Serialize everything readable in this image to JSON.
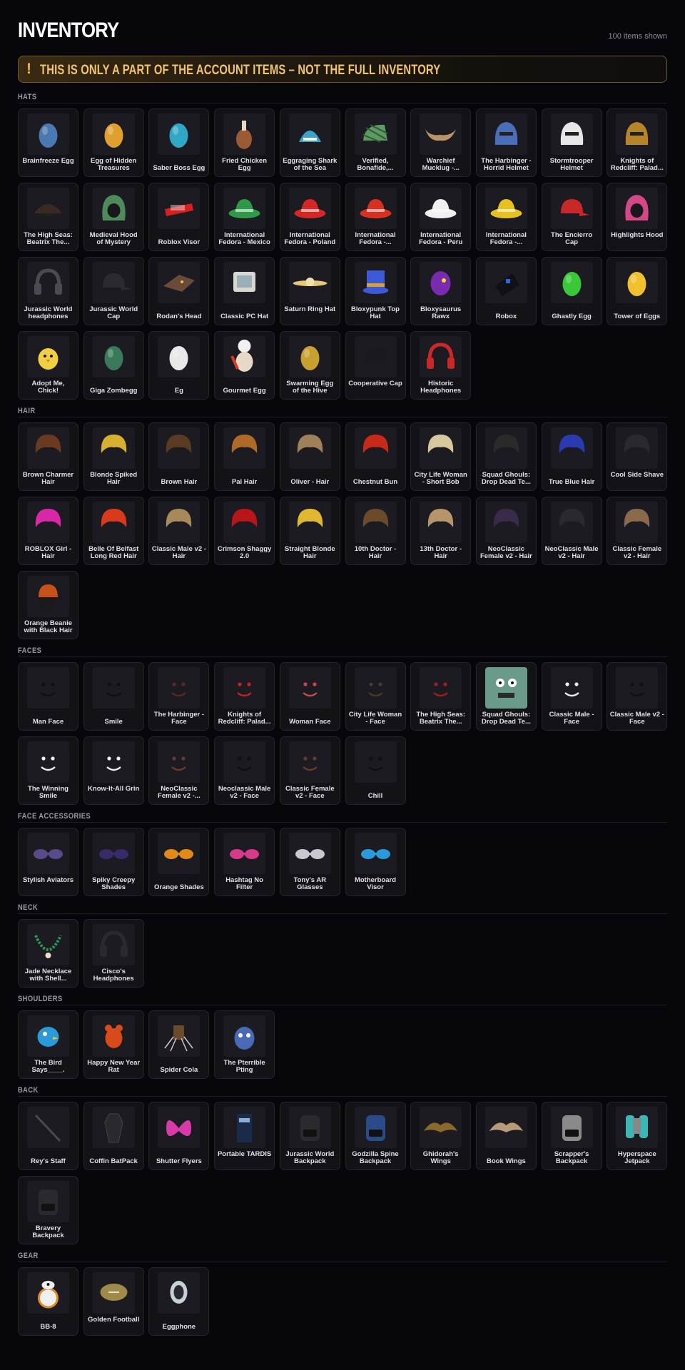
{
  "header": {
    "title": "INVENTORY",
    "items_shown": "100 items shown"
  },
  "banner": {
    "icon": "!",
    "text": "THIS IS ONLY A PART OF THE ACCOUNT ITEMS – NOT THE FULL INVENTORY"
  },
  "sections": [
    {
      "label": "HATS",
      "items": [
        {
          "name": "Brainfreeze Egg",
          "icon": "egg-icon",
          "color": "#4a78b0"
        },
        {
          "name": "Egg of Hidden Treasures",
          "icon": "egg-icon",
          "color": "#e0a030"
        },
        {
          "name": "Saber Boss Egg",
          "icon": "egg-icon",
          "color": "#2fa8c8"
        },
        {
          "name": "Fried Chicken Egg",
          "icon": "drumstick-icon",
          "color": "#9c5a34"
        },
        {
          "name": "Eggraging Shark of the Sea",
          "icon": "shark-icon",
          "color": "#3aa3c8"
        },
        {
          "name": "Verified, Bonafide,...",
          "icon": "plaid-cap-icon",
          "color": "#5d9a62"
        },
        {
          "name": "Warchief Mucklug -...",
          "icon": "horns-icon",
          "color": "#b89468"
        },
        {
          "name": "The Harbinger - Horrid Helmet",
          "icon": "helmet-icon",
          "color": "#4a6fb8"
        },
        {
          "name": "Stormtrooper Helmet",
          "icon": "helmet-icon",
          "color": "#e6e6e6"
        },
        {
          "name": "Knights of Redcliff: Palad...",
          "icon": "helmet-icon",
          "color": "#b8842a"
        }
      ]
    },
    {
      "label": "",
      "items": [
        {
          "name": "The High Seas: Beatrix The...",
          "icon": "pirate-hat-icon",
          "color": "#3a2a26"
        },
        {
          "name": "Medieval Hood of Mystery",
          "icon": "hood-icon",
          "color": "#4f8a5a"
        },
        {
          "name": "Roblox Visor",
          "icon": "visor-icon",
          "color": "#d42020"
        },
        {
          "name": "International Fedora - Mexico",
          "icon": "fedora-icon",
          "color": "#2e9a48"
        },
        {
          "name": "International Fedora - Poland",
          "icon": "fedora-icon",
          "color": "#d62626"
        },
        {
          "name": "International Fedora -...",
          "icon": "fedora-icon",
          "color": "#d83020"
        },
        {
          "name": "International Fedora - Peru",
          "icon": "fedora-icon",
          "color": "#f0f0f0"
        },
        {
          "name": "International Fedora -...",
          "icon": "fedora-icon",
          "color": "#e8c020"
        },
        {
          "name": "The Encierro Cap",
          "icon": "cap-icon",
          "color": "#c82828"
        },
        {
          "name": "Highlights Hood",
          "icon": "hood-icon",
          "color": "#d4488a"
        }
      ]
    },
    {
      "label": "",
      "items": [
        {
          "name": "Jurassic World headphones",
          "icon": "headphones-icon",
          "color": "#4a4a52"
        },
        {
          "name": "Jurassic World Cap",
          "icon": "cap-icon",
          "color": "#2a2a30"
        },
        {
          "name": "Rodan's Head",
          "icon": "creature-head-icon",
          "color": "#6a4a3a"
        },
        {
          "name": "Classic PC Hat",
          "icon": "monitor-icon",
          "color": "#d8d8d0"
        },
        {
          "name": "Saturn Ring Hat",
          "icon": "ring-icon",
          "color": "#e8c878"
        },
        {
          "name": "Bloxypunk Top Hat",
          "icon": "top-hat-icon",
          "color": "#3a5ad8"
        },
        {
          "name": "Bloxysaurus Rawx",
          "icon": "dino-head-icon",
          "color": "#7a2ab0"
        },
        {
          "name": "Robox",
          "icon": "box-icon",
          "color": "#2a6ad8"
        },
        {
          "name": "Ghastly Egg",
          "icon": "egg-icon",
          "color": "#38c838"
        },
        {
          "name": "Tower of Eggs",
          "icon": "egg-icon",
          "color": "#f0c030"
        }
      ]
    },
    {
      "label": "",
      "items": [
        {
          "name": "Adopt Me, Chick!",
          "icon": "chick-icon",
          "color": "#f0d040"
        },
        {
          "name": "Giga Zombegg",
          "icon": "egg-icon",
          "color": "#3a7a5a"
        },
        {
          "name": "Eg",
          "icon": "egg-icon",
          "color": "#e8e8e8"
        },
        {
          "name": "Gourmet Egg",
          "icon": "chef-egg-icon",
          "color": "#f0f0f0"
        },
        {
          "name": "Swarming Egg of the Hive",
          "icon": "egg-icon",
          "color": "#c8a030"
        },
        {
          "name": "Cooperative Cap",
          "icon": "cap-icon",
          "color": "#1a1a1e"
        },
        {
          "name": "Historic Headphones",
          "icon": "headphones-icon",
          "color": "#c82828"
        }
      ]
    },
    {
      "label": "HAIR",
      "items": [
        {
          "name": "Brown Charmer Hair",
          "icon": "hair-icon",
          "color": "#6a3a20"
        },
        {
          "name": "Blonde Spiked Hair",
          "icon": "hair-icon",
          "color": "#d8b030"
        },
        {
          "name": "Brown Hair",
          "icon": "hair-icon",
          "color": "#5a3a22"
        },
        {
          "name": "Pal Hair",
          "icon": "hair-icon",
          "color": "#b06a28"
        },
        {
          "name": "Oliver - Hair",
          "icon": "hair-icon",
          "color": "#a0805a"
        },
        {
          "name": "Chestnut Bun",
          "icon": "hair-icon",
          "color": "#c82a1a"
        },
        {
          "name": "City Life Woman - Short Bob",
          "icon": "hair-icon",
          "color": "#d8c8a0"
        },
        {
          "name": "Squad Ghouls: Drop Dead Te...",
          "icon": "hair-icon",
          "color": "#2a2a2a"
        },
        {
          "name": "True Blue Hair",
          "icon": "hair-icon",
          "color": "#2a3ab0"
        },
        {
          "name": "Cool Side Shave",
          "icon": "hair-icon",
          "color": "#2a2a2e"
        }
      ]
    },
    {
      "label": "",
      "items": [
        {
          "name": "ROBLOX Girl - Hair",
          "icon": "hair-icon",
          "color": "#d828a8"
        },
        {
          "name": "Belle Of Belfast Long Red Hair",
          "icon": "hair-icon",
          "color": "#d83a1a"
        },
        {
          "name": "Classic Male v2 - Hair",
          "icon": "hair-icon",
          "color": "#a88a5a"
        },
        {
          "name": "Crimson Shaggy 2.0",
          "icon": "hair-icon",
          "color": "#b8141a"
        },
        {
          "name": "Straight Blonde Hair",
          "icon": "hair-icon",
          "color": "#e0b830"
        },
        {
          "name": "10th Doctor - Hair",
          "icon": "hair-icon",
          "color": "#6a4a2a"
        },
        {
          "name": "13th Doctor - Hair",
          "icon": "hair-icon",
          "color": "#b8946a"
        },
        {
          "name": "NeoClassic Female v2 - Hair",
          "icon": "hair-icon",
          "color": "#3a2a4a"
        },
        {
          "name": "NeoClassic Male v2 - Hair",
          "icon": "hair-icon",
          "color": "#2a2a2e"
        },
        {
          "name": "Classic Female v2 - Hair",
          "icon": "hair-icon",
          "color": "#8a6a4a"
        }
      ]
    },
    {
      "label": "",
      "items": [
        {
          "name": "Orange Beanie with Black Hair",
          "icon": "beanie-icon",
          "color": "#c8501a"
        }
      ]
    },
    {
      "label": "FACES",
      "items": [
        {
          "name": "Man Face",
          "icon": "face-icon",
          "color": "#101012"
        },
        {
          "name": "Smile",
          "icon": "face-icon",
          "color": "#101012"
        },
        {
          "name": "The Harbinger - Face",
          "icon": "face-icon",
          "color": "#5a2a20"
        },
        {
          "name": "Knights of Redcliff: Palad...",
          "icon": "face-icon",
          "color": "#c82020"
        },
        {
          "name": "Woman Face",
          "icon": "face-icon",
          "color": "#c84a4a"
        },
        {
          "name": "City Life Woman - Face",
          "icon": "face-icon",
          "color": "#4a3a2a"
        },
        {
          "name": "The High Seas: Beatrix The...",
          "icon": "face-icon",
          "color": "#a02020"
        },
        {
          "name": "Squad Ghouls: Drop Dead Te...",
          "icon": "zombie-face-icon",
          "color": "#6a9a8a"
        },
        {
          "name": "Classic Male - Face",
          "icon": "face-icon",
          "color": "#f0f0f0"
        },
        {
          "name": "Classic Male v2 - Face",
          "icon": "face-icon",
          "color": "#101012"
        }
      ]
    },
    {
      "label": "",
      "items": [
        {
          "name": "The Winning Smile",
          "icon": "face-icon",
          "color": "#f0f0f0"
        },
        {
          "name": "Know-It-All Grin",
          "icon": "face-icon",
          "color": "#f0f0f0"
        },
        {
          "name": "NeoClassic Female v2 -...",
          "icon": "face-icon",
          "color": "#6a3a2a"
        },
        {
          "name": "Neoclassic Male v2 - Face",
          "icon": "face-icon",
          "color": "#101012"
        },
        {
          "name": "Classic Female v2 - Face",
          "icon": "face-icon",
          "color": "#6a3a2a"
        },
        {
          "name": "Chill",
          "icon": "face-icon",
          "color": "#101012"
        }
      ]
    },
    {
      "label": "FACE ACCESSORIES",
      "items": [
        {
          "name": "Stylish Aviators",
          "icon": "glasses-icon",
          "color": "#5a4a8a"
        },
        {
          "name": "Spiky Creepy Shades",
          "icon": "glasses-icon",
          "color": "#3a2a6a"
        },
        {
          "name": "Orange Shades",
          "icon": "glasses-icon",
          "color": "#e08a1a"
        },
        {
          "name": "Hashtag No Filter",
          "icon": "glasses-icon",
          "color": "#d83a8a"
        },
        {
          "name": "Tony's AR Glasses",
          "icon": "glasses-icon",
          "color": "#c8c8d0"
        },
        {
          "name": "Motherboard Visor",
          "icon": "glasses-icon",
          "color": "#2a9ad8"
        }
      ]
    },
    {
      "label": "NECK",
      "items": [
        {
          "name": "Jade Necklace with Shell...",
          "icon": "necklace-icon",
          "color": "#2a9a5a"
        },
        {
          "name": "Cisco's Headphones",
          "icon": "headphones-icon",
          "color": "#2a2a2e"
        }
      ]
    },
    {
      "label": "SHOULDERS",
      "items": [
        {
          "name": "The Bird Says____.",
          "icon": "bird-icon",
          "color": "#2a9ad8"
        },
        {
          "name": "Happy New Year Rat",
          "icon": "rat-icon",
          "color": "#d84a1a"
        },
        {
          "name": "Spider Cola",
          "icon": "spider-icon",
          "color": "#6a4a2a"
        },
        {
          "name": "The Pterrible Pting",
          "icon": "creature-icon",
          "color": "#4a6ab8"
        }
      ]
    },
    {
      "label": "BACK",
      "items": [
        {
          "name": "Rey's Staff",
          "icon": "staff-icon",
          "color": "#4a4a4a"
        },
        {
          "name": "Coffin BatPack",
          "icon": "coffin-icon",
          "color": "#2a2a2e"
        },
        {
          "name": "Shutter Flyers",
          "icon": "butterfly-icon",
          "color": "#d83aa8"
        },
        {
          "name": "Portable TARDIS",
          "icon": "tardis-icon",
          "color": "#1a2a4a"
        },
        {
          "name": "Jurassic World Backpack",
          "icon": "backpack-icon",
          "color": "#2a2a2e"
        },
        {
          "name": "Godzilla Spine Backpack",
          "icon": "backpack-icon",
          "color": "#2a4a8a"
        },
        {
          "name": "Ghidorah's Wings",
          "icon": "wings-icon",
          "color": "#8a6a2a"
        },
        {
          "name": "Book Wings",
          "icon": "wings-icon",
          "color": "#b89a7a"
        },
        {
          "name": "Scrapper's Backpack",
          "icon": "backpack-icon",
          "color": "#8a8a8a"
        },
        {
          "name": "Hyperspace Jetpack",
          "icon": "jetpack-icon",
          "color": "#3ab8b8"
        }
      ]
    },
    {
      "label": "",
      "items": [
        {
          "name": "Bravery Backpack",
          "icon": "backpack-icon",
          "color": "#2a2a2e"
        }
      ]
    },
    {
      "label": "GEAR",
      "items": [
        {
          "name": "BB-8",
          "icon": "droid-icon",
          "color": "#e08a2a"
        },
        {
          "name": "Golden Football",
          "icon": "football-icon",
          "color": "#a08a4a"
        },
        {
          "name": "Eggphone",
          "icon": "phone-icon",
          "color": "#c8d0d8"
        }
      ]
    }
  ]
}
